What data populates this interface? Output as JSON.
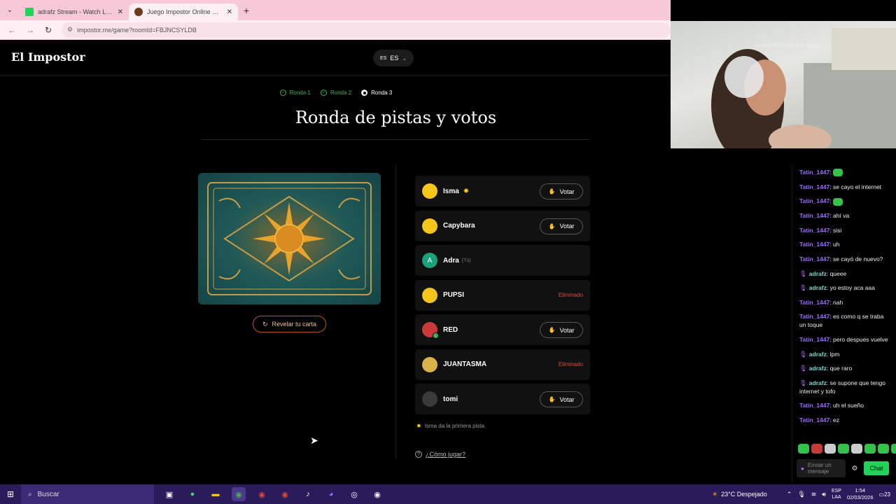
{
  "browser": {
    "tabs": [
      {
        "title": "adrafz Stream - Watch Live on Kick",
        "favicon_color": "#22d35a"
      },
      {
        "title": "Juego Impostor Online Gratis",
        "favicon_color": "#6b3b1a"
      }
    ],
    "url": "impostor.me/game?roomId=FBJNCSYLDB"
  },
  "app": {
    "logo": "El Impostor",
    "lang": {
      "flag": "ES",
      "label": "ES"
    },
    "steps": [
      "Ronda 1",
      "Ronda 2",
      "Ronda 3"
    ],
    "title": "Ronda de pistas y votos",
    "reveal_label": "Revelar tu carta",
    "vote_label": "Votar",
    "eliminated_label": "Eliminado",
    "players": [
      {
        "name": "Isma",
        "tag": "",
        "status": "vote",
        "starter": true,
        "avatar_color": "#f5c51a",
        "avatar_text": ""
      },
      {
        "name": "Capybara",
        "tag": "",
        "status": "vote",
        "starter": false,
        "avatar_color": "#f5c51a",
        "avatar_text": ""
      },
      {
        "name": "Adra",
        "tag": "(Tú)",
        "status": "self",
        "starter": false,
        "avatar_color": "#1aa37a",
        "avatar_text": "A"
      },
      {
        "name": "PUPSI",
        "tag": "",
        "status": "eliminated",
        "starter": false,
        "avatar_color": "#f5c51a",
        "avatar_text": ""
      },
      {
        "name": "RED",
        "tag": "",
        "status": "vote",
        "starter": false,
        "avatar_color": "#c83a3a",
        "avatar_text": ""
      },
      {
        "name": "JUANTASMA",
        "tag": "",
        "status": "eliminated",
        "starter": false,
        "avatar_color": "#d9b24a",
        "avatar_text": ""
      },
      {
        "name": "tomi",
        "tag": "",
        "status": "vote",
        "starter": false,
        "avatar_color": "#3a3a3a",
        "avatar_text": ""
      }
    ],
    "hint": "Isma da la primera pista",
    "howto": "¿Cómo jugar?"
  },
  "webcam": {
    "watermark": "usingvirtualcam.app"
  },
  "chat": {
    "messages": [
      {
        "user": "Tatin_1447",
        "text": "",
        "kind": "t"
      },
      {
        "user": "Tatin_1447",
        "text": "se cayo el internet",
        "kind": "t"
      },
      {
        "user": "Tatin_1447",
        "text": "",
        "kind": "t"
      },
      {
        "user": "Tatin_1447",
        "text": "ahí va",
        "kind": "t"
      },
      {
        "user": "Tatin_1447",
        "text": "sisi",
        "kind": "t"
      },
      {
        "user": "Tatin_1447",
        "text": "uh",
        "kind": "t"
      },
      {
        "user": "Tatin_1447",
        "text": "se cayó de nuevo?",
        "kind": "t"
      },
      {
        "user": "adrafz",
        "text": "queee",
        "kind": "a"
      },
      {
        "user": "adrafz",
        "text": "yo estoy aca aaa",
        "kind": "a"
      },
      {
        "user": "Tatin_1447",
        "text": "nah",
        "kind": "t"
      },
      {
        "user": "Tatin_1447",
        "text": "es como q se traba un toque",
        "kind": "t"
      },
      {
        "user": "Tatin_1447",
        "text": "pero despues vuelve",
        "kind": "t"
      },
      {
        "user": "adrafz",
        "text": "lpm",
        "kind": "a"
      },
      {
        "user": "adrafz",
        "text": "que raro",
        "kind": "a"
      },
      {
        "user": "adrafz",
        "text": "se supone que tengo internet y tofo",
        "kind": "a"
      },
      {
        "user": "Tatin_1447",
        "text": "uh el sueño",
        "kind": "t"
      },
      {
        "user": "Tatin_1447",
        "text": "ez",
        "kind": "t"
      }
    ],
    "input_placeholder": "Enviar un mensaje",
    "send_label": "Chat"
  },
  "taskbar": {
    "search_label": "Buscar",
    "weather": "23°C Despejado",
    "lang": "ESP",
    "lang2": "LAA",
    "time": "1:54",
    "date": "02/03/2026",
    "notif_count": "23"
  }
}
